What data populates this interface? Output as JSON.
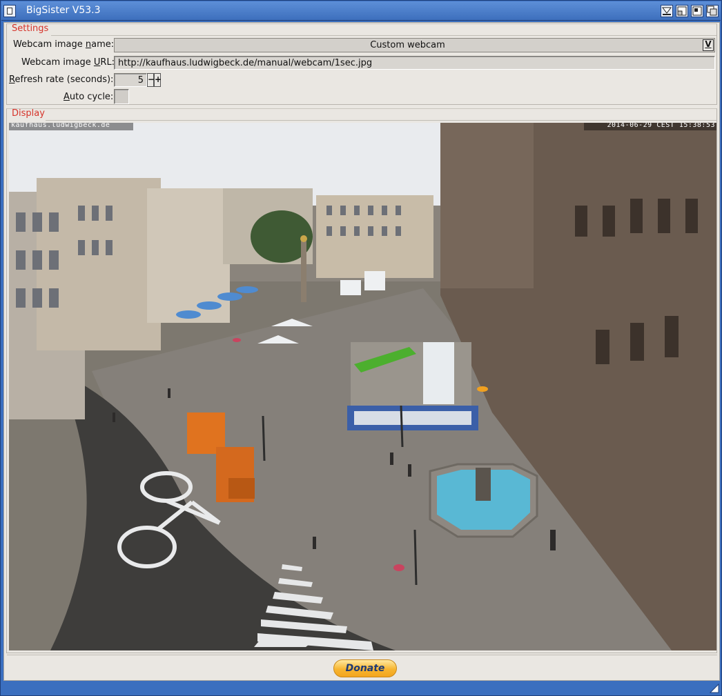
{
  "window": {
    "title": "BigSister V53.3"
  },
  "settings": {
    "group_title": "Settings",
    "image_name_label_pre": "Webcam image ",
    "image_name_label_key": "n",
    "image_name_label_post": "ame:",
    "image_name_value": "Custom webcam",
    "dropdown_glyph": "V",
    "url_label_pre": "Webcam image ",
    "url_label_key": "U",
    "url_label_post": "RL:",
    "url_value": "http://kaufhaus.ludwigbeck.de/manual/webcam/1sec.jpg",
    "refresh_label_key": "R",
    "refresh_label_post": "efresh rate (seconds):",
    "refresh_value": "5",
    "stepper_minus": "−",
    "stepper_plus": "+",
    "autocycle_label_pre": "",
    "autocycle_label_key": "A",
    "autocycle_label_post": "uto cycle:",
    "autocycle_checked": false
  },
  "display": {
    "group_title": "Display",
    "overlay_left": "kaufhaus.ludwigbeck.de",
    "overlay_right": "2014-06-29 CEST 15:38:53"
  },
  "footer": {
    "donate_label": "Donate"
  },
  "colors": {
    "accent_group_title": "#d6332a",
    "titlebar": "#3d6fbd",
    "window_bg": "#eae7e2",
    "donate": "#f7b531"
  },
  "icons": {
    "close": "close-icon",
    "iconify": "iconify-icon",
    "zoom": "zoom-icon",
    "depth": "depth-icon",
    "resize": "resize-grip-icon"
  }
}
